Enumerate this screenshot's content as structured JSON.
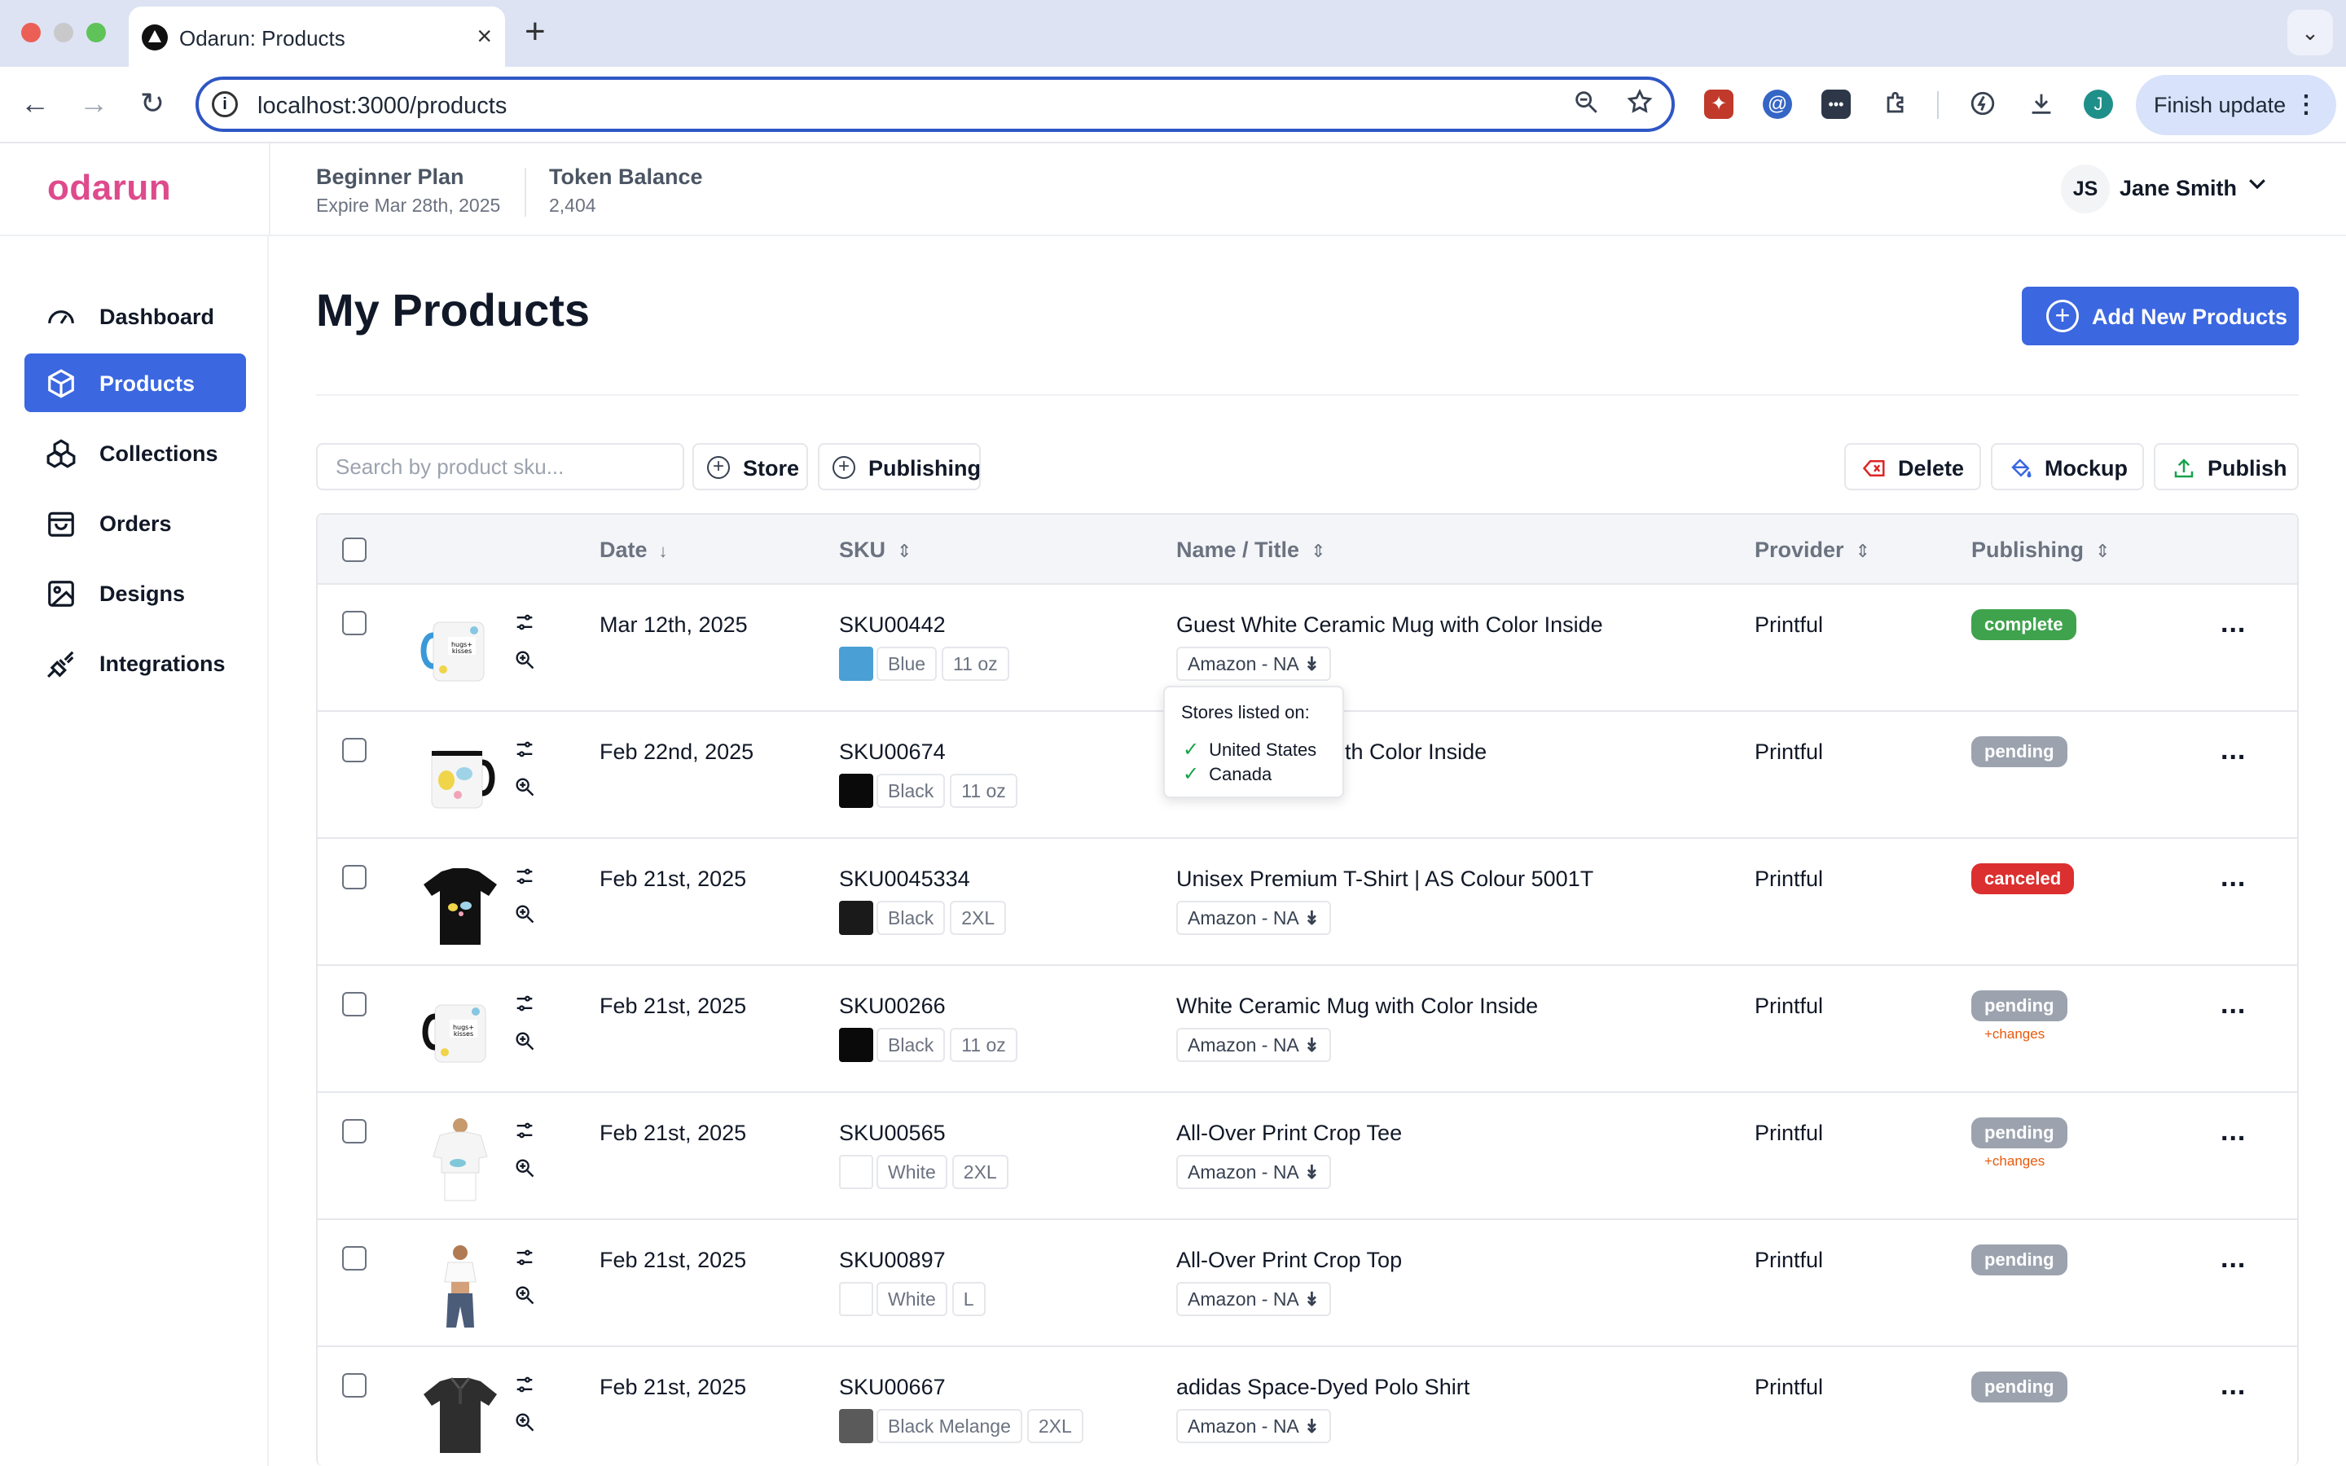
{
  "browser": {
    "tab_title": "Odarun: Products",
    "url": "localhost:3000/products",
    "finish_update_label": "Finish update",
    "profile_initial": "J"
  },
  "header": {
    "brand": "odarun",
    "plan_name": "Beginner Plan",
    "plan_expiry": "Expire Mar 28th, 2025",
    "token_label": "Token Balance",
    "token_value": "2,404",
    "user_initials": "JS",
    "user_name": "Jane Smith"
  },
  "sidebar": {
    "items": [
      {
        "label": "Dashboard",
        "icon": "gauge-icon"
      },
      {
        "label": "Products",
        "icon": "box-icon",
        "active": true
      },
      {
        "label": "Collections",
        "icon": "stack-icon"
      },
      {
        "label": "Orders",
        "icon": "bag-icon"
      },
      {
        "label": "Designs",
        "icon": "image-icon"
      },
      {
        "label": "Integrations",
        "icon": "plug-icon"
      }
    ]
  },
  "main": {
    "title": "My Products",
    "add_button": "Add New Products",
    "search_placeholder": "Search by product sku...",
    "filters": [
      "Store",
      "Publishing"
    ],
    "actions": {
      "delete": "Delete",
      "mockup": "Mockup",
      "publish": "Publish"
    }
  },
  "table": {
    "columns": {
      "date": "Date",
      "sku": "SKU",
      "name": "Name / Title",
      "provider": "Provider",
      "publishing": "Publishing"
    },
    "rows": [
      {
        "date": "Mar 12th, 2025",
        "sku": "SKU00442",
        "color_name": "Blue",
        "swatch": "#4a9fd4",
        "size": "11 oz",
        "name": "Guest White Ceramic Mug with Color Inside",
        "store": "Amazon - NA",
        "provider": "Printful",
        "status": "complete",
        "status_color": "#3fa34d",
        "changes": "",
        "thumb": "mug-blue"
      },
      {
        "date": "Feb 22nd, 2025",
        "sku": "SKU00674",
        "color_name": "Black",
        "swatch": "#0a0a0a",
        "size": "11 oz",
        "name": "ug with Color Inside",
        "store": "",
        "provider": "Printful",
        "status": "pending",
        "status_color": "#9ca3af",
        "changes": "",
        "thumb": "mug-black"
      },
      {
        "date": "Feb 21st, 2025",
        "sku": "SKU0045334",
        "color_name": "Black",
        "swatch": "#1a1a1a",
        "size": "2XL",
        "name": "Unisex Premium T-Shirt | AS Colour 5001T",
        "store": "Amazon - NA",
        "provider": "Printful",
        "status": "canceled",
        "status_color": "#dc2f2f",
        "changes": "",
        "thumb": "tshirt-black"
      },
      {
        "date": "Feb 21st, 2025",
        "sku": "SKU00266",
        "color_name": "Black",
        "swatch": "#0a0a0a",
        "size": "11 oz",
        "name": "White Ceramic Mug with Color Inside",
        "store": "Amazon - NA",
        "provider": "Printful",
        "status": "pending",
        "status_color": "#9ca3af",
        "changes": "+changes",
        "thumb": "mug-black-2"
      },
      {
        "date": "Feb 21st, 2025",
        "sku": "SKU00565",
        "color_name": "White",
        "swatch": "#ffffff",
        "size": "2XL",
        "name": "All-Over Print Crop Tee",
        "store": "Amazon - NA",
        "provider": "Printful",
        "status": "pending",
        "status_color": "#9ca3af",
        "changes": "+changes",
        "thumb": "crop-tee"
      },
      {
        "date": "Feb 21st, 2025",
        "sku": "SKU00897",
        "color_name": "White",
        "swatch": "#ffffff",
        "size": "L",
        "name": "All-Over Print Crop Top",
        "store": "Amazon - NA",
        "provider": "Printful",
        "status": "pending",
        "status_color": "#9ca3af",
        "changes": "",
        "thumb": "crop-top"
      },
      {
        "date": "Feb 21st, 2025",
        "sku": "SKU00667",
        "color_name": "Black Melange",
        "swatch": "#5a5a5a",
        "size": "2XL",
        "name": "adidas Space-Dyed Polo Shirt",
        "store": "Amazon - NA",
        "provider": "Printful",
        "status": "pending",
        "status_color": "#9ca3af",
        "changes": "",
        "thumb": "polo"
      }
    ],
    "more_label": "..."
  },
  "popover": {
    "title": "Stores listed on:",
    "stores": [
      "United States",
      "Canada"
    ]
  }
}
